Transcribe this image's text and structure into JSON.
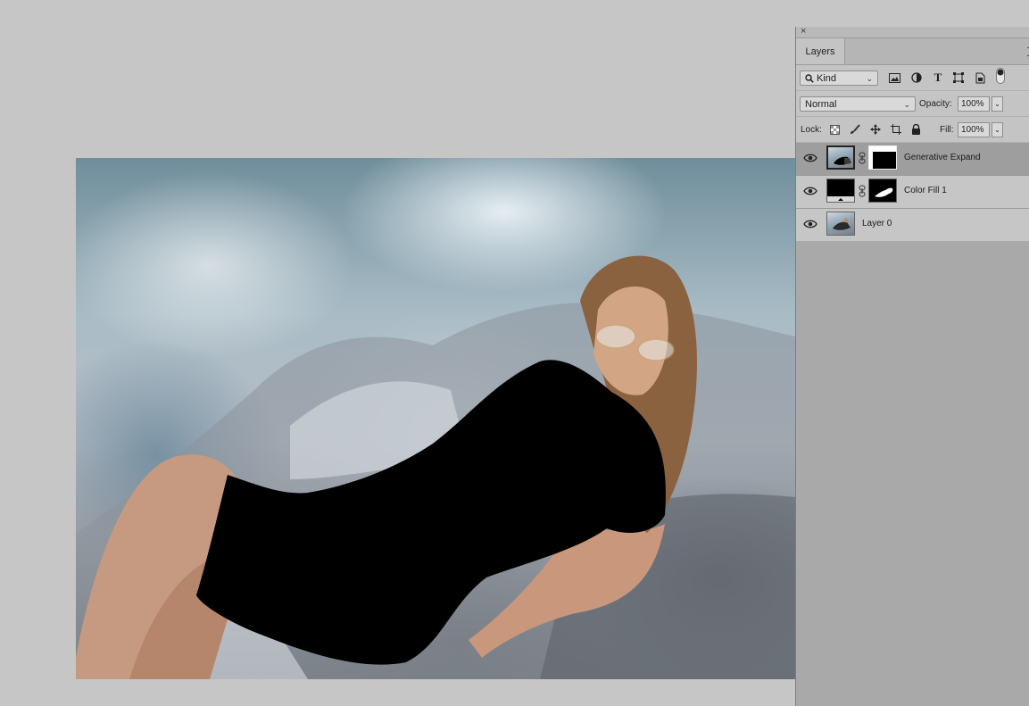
{
  "layers_panel": {
    "close_glyph": "×",
    "tab_label": "Layers",
    "filter": {
      "kind_label": "Kind",
      "icons": [
        "image-filter-icon",
        "adjustment-filter-icon",
        "type-filter-icon",
        "shape-filter-icon",
        "smart-object-filter-icon",
        "filter-toggle-icon"
      ]
    },
    "blend_mode": "Normal",
    "opacity_label": "Opacity:",
    "opacity_value": "100%",
    "lock_label": "Lock:",
    "lock_icons": [
      "lock-transparent-pixels-icon",
      "lock-image-pixels-icon",
      "lock-position-icon",
      "lock-artboard-icon",
      "lock-all-icon"
    ],
    "fill_label": "Fill:",
    "fill_value": "100%",
    "layers": [
      {
        "name": "Generative Expand",
        "selected": true,
        "has_mask": true
      },
      {
        "name": "Color Fill 1",
        "selected": false,
        "has_mask": true
      },
      {
        "name": "Layer 0",
        "selected": false,
        "has_mask": false
      }
    ]
  },
  "colors": {
    "workspace_bg": "#c6c6c6",
    "panel_bg": "#a8a8a8",
    "selected_layer_bg": "#9e9e9e",
    "dress_fill": "#000000"
  }
}
